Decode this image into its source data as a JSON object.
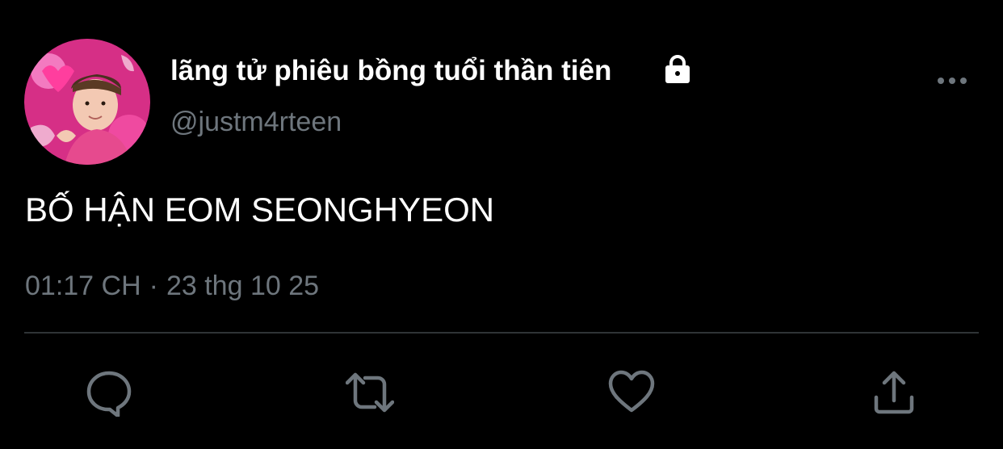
{
  "user": {
    "display_name": "lãng tử phiêu bồng tuổi thần tiên",
    "handle": "@justm4rteen",
    "avatar_icon": "profile-photo",
    "protected_icon": "lock-icon"
  },
  "tweet": {
    "text": "BỐ HẬN EOM SEONGHYEON",
    "time": "01:17 CH",
    "separator": "·",
    "date": "23 thg 10 25"
  },
  "actions": {
    "reply_icon": "reply-icon",
    "retweet_icon": "retweet-icon",
    "like_icon": "heart-icon",
    "share_icon": "share-icon",
    "more_icon": "more-icon"
  },
  "colors": {
    "background": "#000000",
    "primary_text": "#ffffff",
    "secondary_text": "#6e767d",
    "divider": "#2f3336",
    "icon": "#6e767d"
  }
}
